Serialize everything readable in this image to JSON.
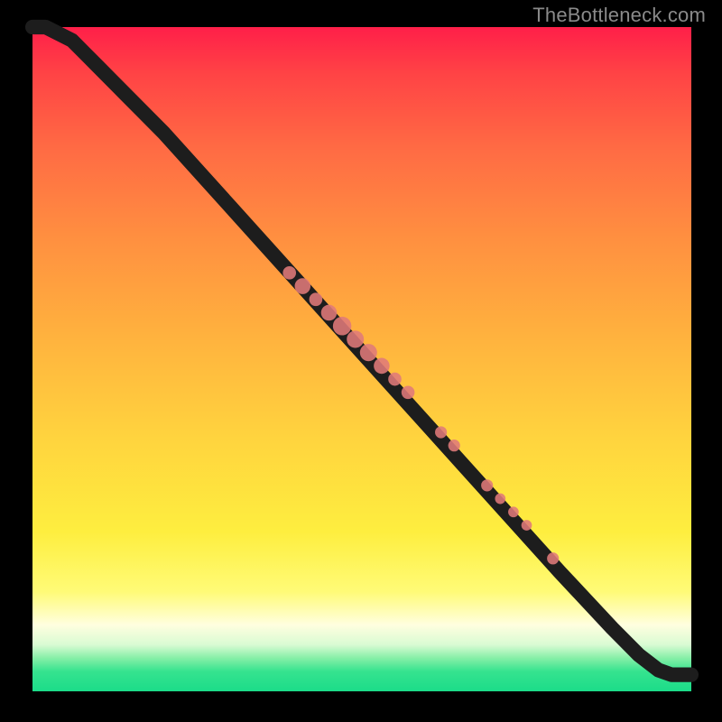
{
  "watermark": "TheBottleneck.com",
  "colors": {
    "gradient_top": "#ff1f49",
    "gradient_mid": "#ffd43e",
    "gradient_pale": "#fffedf",
    "gradient_green": "#1bdc89",
    "line": "#1d1d1d",
    "point": "#e07a7a",
    "frame": "#000000",
    "watermark": "#8a8a8a"
  },
  "chart_data": {
    "type": "line",
    "title": "",
    "subtitle": "",
    "xlabel": "",
    "ylabel": "",
    "xlim": [
      0,
      100
    ],
    "ylim": [
      0,
      100
    ],
    "grid": false,
    "legend": null,
    "series": [
      {
        "name": "curve",
        "x": [
          0,
          2,
          4,
          6,
          8,
          10,
          14,
          20,
          30,
          40,
          50,
          60,
          70,
          80,
          88,
          92,
          95,
          97,
          100
        ],
        "y": [
          100,
          100,
          99,
          98,
          96,
          94,
          90,
          84,
          73,
          62,
          51,
          40,
          29,
          18,
          9.5,
          5.5,
          3.2,
          2.5,
          2.5
        ]
      }
    ],
    "points": [
      {
        "x": 39,
        "y": 63,
        "r": 1.0
      },
      {
        "x": 41,
        "y": 61,
        "r": 1.2
      },
      {
        "x": 43,
        "y": 59,
        "r": 1.0
      },
      {
        "x": 45,
        "y": 57,
        "r": 1.2
      },
      {
        "x": 47,
        "y": 55,
        "r": 1.4
      },
      {
        "x": 49,
        "y": 53,
        "r": 1.3
      },
      {
        "x": 51,
        "y": 51,
        "r": 1.3
      },
      {
        "x": 53,
        "y": 49,
        "r": 1.2
      },
      {
        "x": 55,
        "y": 47,
        "r": 1.0
      },
      {
        "x": 57,
        "y": 45,
        "r": 1.0
      },
      {
        "x": 62,
        "y": 39,
        "r": 0.9
      },
      {
        "x": 64,
        "y": 37,
        "r": 0.9
      },
      {
        "x": 69,
        "y": 31,
        "r": 0.9
      },
      {
        "x": 71,
        "y": 29,
        "r": 0.8
      },
      {
        "x": 73,
        "y": 27,
        "r": 0.8
      },
      {
        "x": 75,
        "y": 25,
        "r": 0.8
      },
      {
        "x": 79,
        "y": 20,
        "r": 0.9
      }
    ]
  }
}
